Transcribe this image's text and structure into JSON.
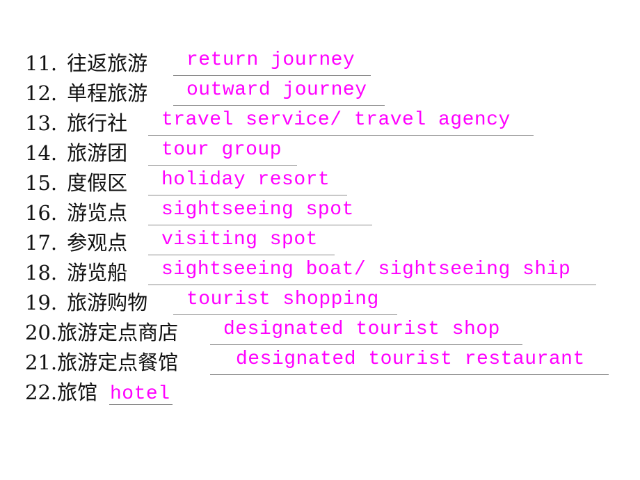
{
  "colors": {
    "prompt": "#111111",
    "answer": "#ff00ff",
    "underline": "#8a8a8a"
  },
  "items": [
    {
      "num": "11.",
      "zh": "往返旅游",
      "en": "return journey"
    },
    {
      "num": "12.",
      "zh": "单程旅游",
      "en": "outward journey"
    },
    {
      "num": "13.",
      "zh": "旅行社",
      "en": "travel service/ travel agency"
    },
    {
      "num": "14.",
      "zh": "旅游团",
      "en": "tour group"
    },
    {
      "num": "15.",
      "zh": "度假区",
      "en": "holiday resort"
    },
    {
      "num": "16.",
      "zh": "游览点",
      "en": "sightseeing spot"
    },
    {
      "num": "17.",
      "zh": "参观点",
      "en": "visiting spot"
    },
    {
      "num": "18.",
      "zh": "游览船",
      "en": "sightseeing boat/ sightseeing ship"
    },
    {
      "num": "19.",
      "zh": "旅游购物",
      "en": "tourist shopping"
    },
    {
      "num": "20.",
      "zh": "旅游定点商店",
      "en": "designated tourist shop"
    },
    {
      "num": "21.",
      "zh": "旅游定点餐馆",
      "en": "designated tourist restaurant"
    },
    {
      "num": "22.",
      "zh": "旅馆",
      "en": "hotel"
    }
  ]
}
